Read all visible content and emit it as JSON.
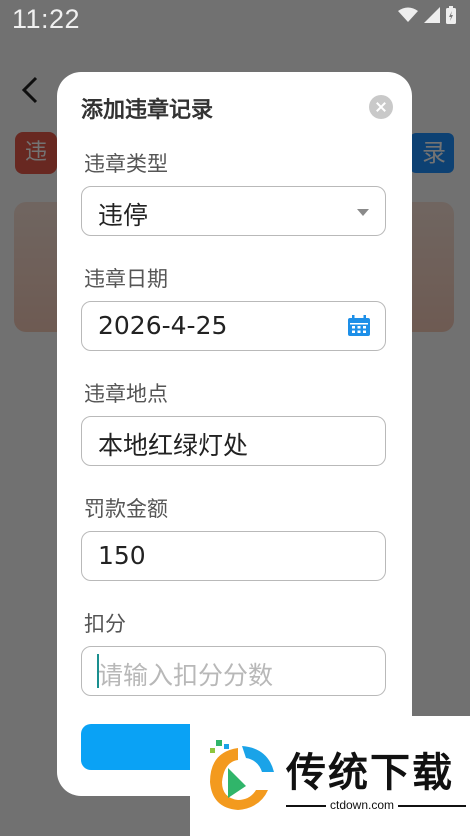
{
  "status_bar": {
    "time": "11:22"
  },
  "background": {
    "card_icon_text": "违",
    "button_text": "录"
  },
  "dialog": {
    "title": "添加违章记录",
    "fields": {
      "type": {
        "label": "违章类型",
        "value": "违停"
      },
      "date": {
        "label": "违章日期",
        "value": "2026-4-25"
      },
      "location": {
        "label": "违章地点",
        "value": "本地红绿灯处"
      },
      "fine": {
        "label": "罚款金额",
        "value": "150"
      },
      "points": {
        "label": "扣分",
        "placeholder": "请输入扣分分数"
      }
    }
  },
  "watermark": {
    "text": "传统下载",
    "url": "ctdown.com"
  },
  "colors": {
    "accent": "#0aa2f5",
    "overlay": "rgba(0,0,0,0.55)"
  }
}
